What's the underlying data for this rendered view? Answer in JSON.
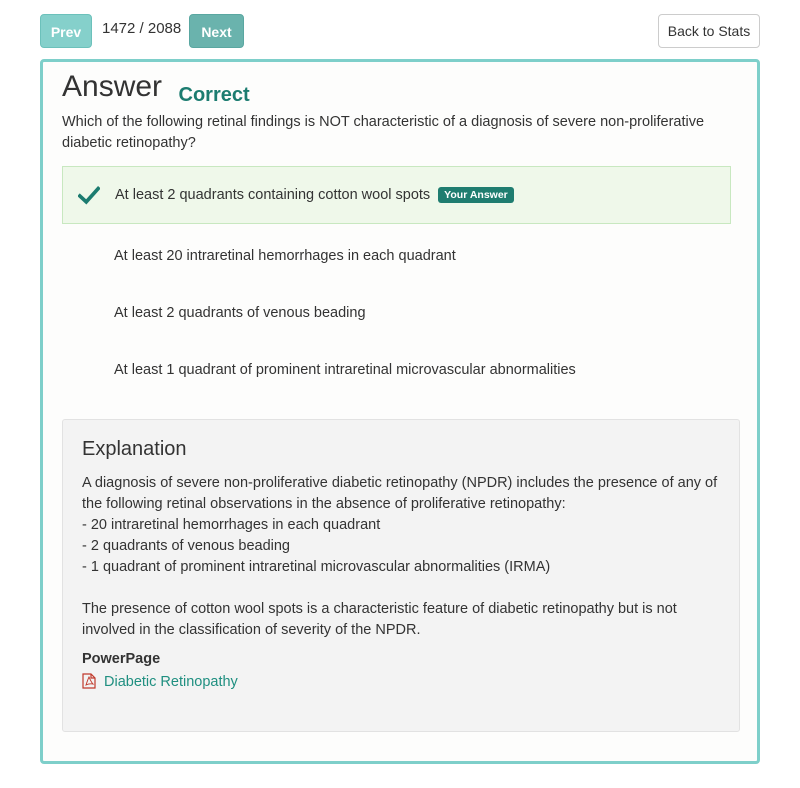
{
  "nav": {
    "prev_label": "Prev",
    "counter": "1472 / 2088",
    "next_label": "Next",
    "back_label": "Back to Stats"
  },
  "card": {
    "title": "Answer",
    "status": "Correct",
    "question": "Which of the following retinal findings is NOT characteristic of a diagnosis of severe non-proliferative diabetic retinopathy?",
    "options": [
      {
        "text": "At least 2 quadrants containing cotton wool spots",
        "selected": true,
        "badge": "Your Answer"
      },
      {
        "text": "At least 20 intraretinal hemorrhages in each quadrant",
        "selected": false
      },
      {
        "text": "At least 2 quadrants of venous beading",
        "selected": false
      },
      {
        "text": "At least 1 quadrant of prominent intraretinal microvascular abnormalities",
        "selected": false
      }
    ]
  },
  "explanation": {
    "heading": "Explanation",
    "lines": [
      "A diagnosis of severe non-proliferative diabetic retinopathy (NPDR) includes the presence of any of the following retinal observations in the absence of proliferative retinopathy:",
      "- 20 intraretinal hemorrhages in each quadrant",
      "- 2 quadrants of venous beading",
      "- 1 quadrant of prominent intraretinal microvascular abnormalities (IRMA)"
    ],
    "paragraph2": "The presence of cotton wool spots is a characteristic feature of diabetic retinopathy but is not involved in the classification of severity of the NPDR.",
    "powerpage_label": "PowerPage",
    "powerpage_link": "Diabetic Retinopathy"
  },
  "colors": {
    "accent": "#7ecfca",
    "correct": "#1c7c70",
    "selected_bg": "#eff8ea",
    "link": "#1f8f80",
    "pdf_icon": "#c0392b"
  },
  "icons": {
    "check": "check-icon",
    "pdf": "pdf-file-icon"
  }
}
